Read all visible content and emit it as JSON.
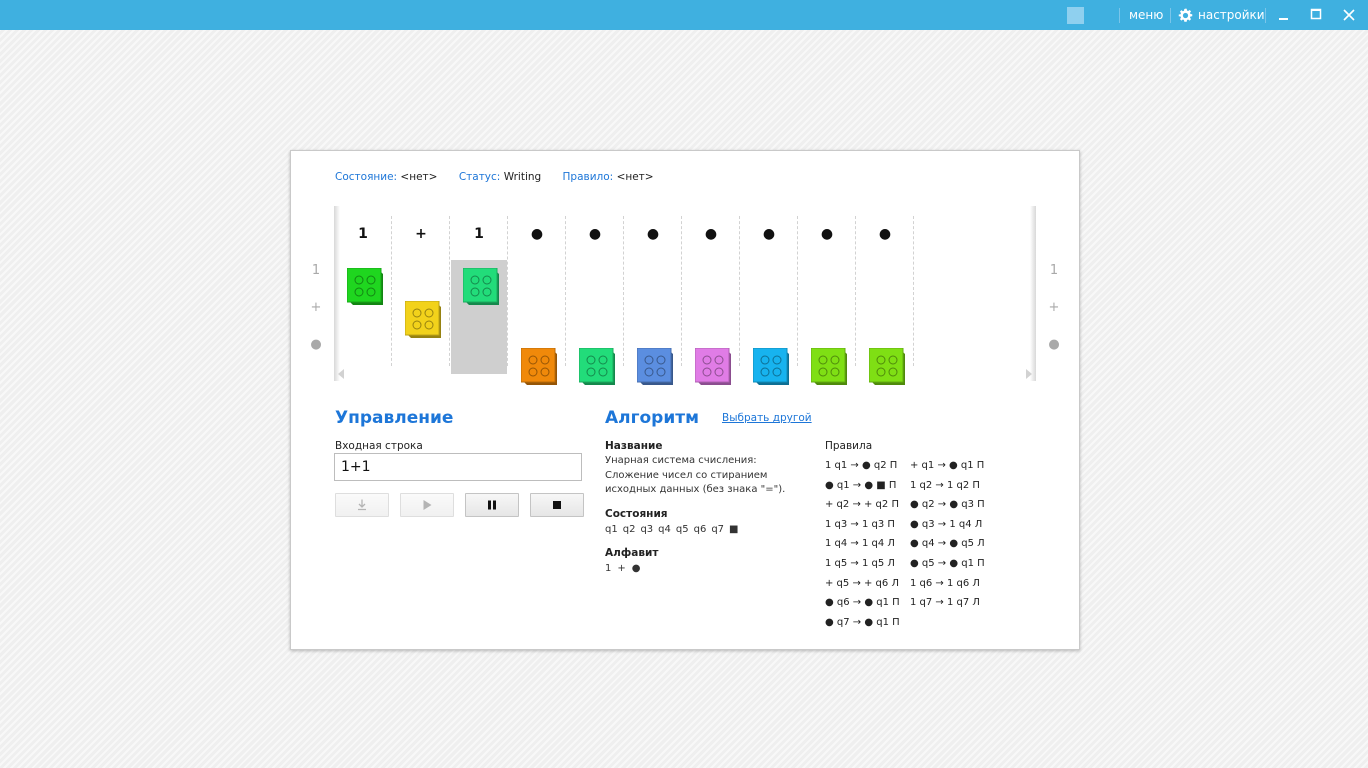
{
  "window": {
    "menu_label": "меню",
    "settings_label": "настройки",
    "accent": "#3fb0e0"
  },
  "status": {
    "state_label": "Состояние:",
    "state_value": "<нет>",
    "status_label": "Статус:",
    "status_value": "Writing",
    "rule_label": "Правило:",
    "rule_value": "<нет>"
  },
  "tape": {
    "left_alphabet": [
      "1",
      "+",
      "●"
    ],
    "right_alphabet": [
      "1",
      "+",
      "●"
    ],
    "active_cell": 2,
    "cells": [
      {
        "symbol": "1",
        "color": "#1fd61f",
        "level": 0
      },
      {
        "symbol": "+",
        "color": "#f2d21b",
        "level": 1
      },
      {
        "symbol": "1",
        "color": "#22dc7a",
        "level": 0
      },
      {
        "symbol": "●",
        "color": "#f0890a",
        "level": 2
      },
      {
        "symbol": "●",
        "color": "#22dc7a",
        "level": 2
      },
      {
        "symbol": "●",
        "color": "#5b8ee0",
        "level": 2
      },
      {
        "symbol": "●",
        "color": "#e07ce6",
        "level": 2
      },
      {
        "symbol": "●",
        "color": "#17b3ef",
        "level": 2
      },
      {
        "symbol": "●",
        "color": "#7fdf14",
        "level": 2
      },
      {
        "symbol": "●",
        "color": "#7fdf14",
        "level": 2
      }
    ]
  },
  "control": {
    "title": "Управление",
    "input_label": "Входная строка",
    "input_value": "1+1",
    "buttons": [
      "load",
      "play",
      "pause",
      "stop"
    ]
  },
  "algorithm": {
    "title": "Алгоритм",
    "choose_other": "Выбрать другой",
    "name_label": "Название",
    "name_value": "Унарная система счисления: Сложение чисел со стиранием исходных данных (без знака \"=\").",
    "states_label": "Состояния",
    "states": [
      "q1",
      "q2",
      "q3",
      "q4",
      "q5",
      "q6",
      "q7",
      "■"
    ],
    "alphabet_label": "Алфавит",
    "alphabet": [
      "1",
      "+",
      "●"
    ],
    "rules_label": "Правила",
    "rules_col1": [
      "1 q1 → ● q2 П",
      "● q1 → ● ■ П",
      "+ q2 → + q2 П",
      "1 q3 → 1 q3 П",
      "1 q4 → 1 q4 Л",
      "1 q5 → 1 q5 Л",
      "+ q5 → + q6 Л",
      "● q6 → ● q1 П",
      "● q7 → ● q1 П"
    ],
    "rules_col2": [
      "+ q1 → ● q1 П",
      "1 q2 → 1 q2 П",
      "● q2 → ● q3 П",
      "● q3 → 1 q4 Л",
      "● q4 → ● q5 Л",
      "● q5 → ● q1 П",
      "1 q6 → 1 q6 Л",
      "1 q7 → 1 q7 Л"
    ]
  }
}
